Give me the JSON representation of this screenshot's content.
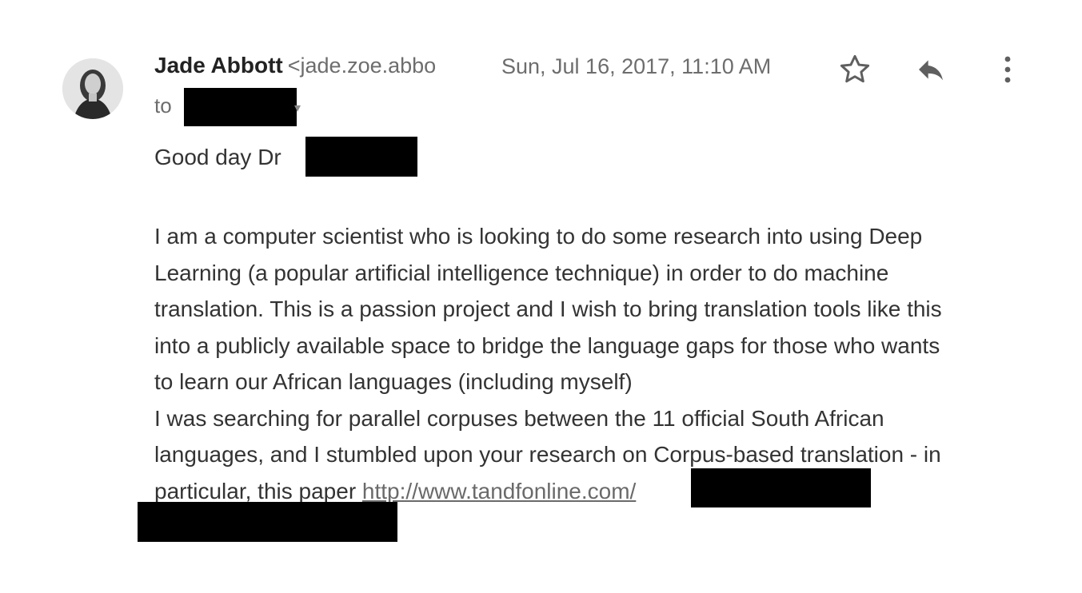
{
  "email": {
    "sender_name": "Jade Abbott",
    "sender_email": "<jade.zoe.abbo",
    "date": "Sun, Jul 16, 2017, 11:10 AM",
    "to_label": "to",
    "greeting": "Good day Dr",
    "body_lines": [
      "I am a computer scientist who is looking to do some research into using Deep",
      "Learning (a popular artificial intelligence technique) in order to do machine",
      "translation. This is a passion project and I wish to bring translation tools like this",
      "into a publicly available space to bridge the language gaps for those who wants",
      "to learn our African languages (including myself)",
      "I was searching for parallel corpuses between the 11 official South African",
      "languages, and I stumbled upon your research on Corpus-based translation - in"
    ],
    "last_line_prefix": "particular, this paper ",
    "link_text": "http://www.tandfonline.com/"
  },
  "icons": {
    "star": "star-icon",
    "reply": "reply-icon",
    "more": "more-vert-icon"
  }
}
